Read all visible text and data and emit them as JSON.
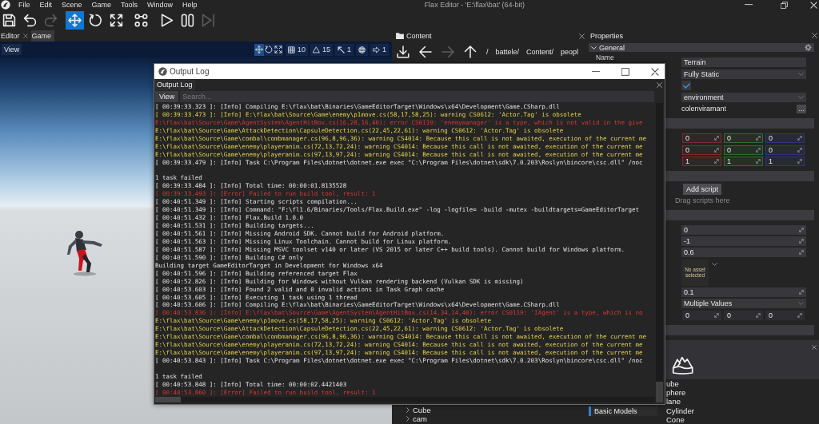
{
  "app": {
    "menu": [
      "File",
      "Edit",
      "Scene",
      "Game",
      "Tools",
      "Window",
      "Help"
    ],
    "title": "Flax Editor - 'E:\\flax\\bat' (64-bit)"
  },
  "toolbar": [
    {
      "kind": "save",
      "selected": false,
      "disabled": false
    },
    {
      "kind": "undo",
      "selected": false,
      "disabled": false
    },
    {
      "kind": "redo",
      "selected": false,
      "disabled": true
    },
    {
      "kind": "translate",
      "selected": true,
      "disabled": false
    },
    {
      "kind": "rotate",
      "selected": false,
      "disabled": false
    },
    {
      "kind": "scale",
      "selected": false,
      "disabled": false
    },
    {
      "kind": "snap",
      "selected": false,
      "disabled": false
    },
    {
      "kind": "play",
      "selected": false,
      "disabled": false
    },
    {
      "kind": "pause",
      "selected": false,
      "disabled": false
    },
    {
      "kind": "step",
      "selected": false,
      "disabled": true
    }
  ],
  "editor_tabs": [
    {
      "label": "Editor",
      "selected": true
    },
    {
      "label": "Game",
      "selected": false
    }
  ],
  "viewport": {
    "view_button": "View",
    "gizmo_modes": [
      {
        "kind": "translate",
        "selected": true
      },
      {
        "kind": "rotate",
        "selected": false
      },
      {
        "kind": "scale",
        "selected": false
      }
    ],
    "snapping": [
      {
        "kind": "grid",
        "value": "10"
      },
      {
        "kind": "angle",
        "value": "15"
      },
      {
        "kind": "scale",
        "value": "1"
      },
      {
        "kind": "space"
      },
      {
        "kind": "speed",
        "value": "1"
      }
    ]
  },
  "content": {
    "title": "Content",
    "nav": [
      {
        "kind": "import",
        "disabled": false
      },
      {
        "kind": "back",
        "disabled": false
      },
      {
        "kind": "forward",
        "disabled": true
      },
      {
        "kind": "up",
        "disabled": false
      }
    ],
    "path": [
      "/",
      "battele/",
      "Content/",
      "peopl"
    ],
    "tree": [
      {
        "label": "Cube",
        "expanded": false
      },
      {
        "label": "cam",
        "expanded": false
      }
    ]
  },
  "properties": {
    "title": "Properties",
    "group": {
      "label": "General",
      "expanded": true
    },
    "rows": [
      {
        "kind": "text",
        "label": "Name",
        "value": "Terrain"
      },
      {
        "kind": "dropdown",
        "value": "Fully Static"
      },
      {
        "kind": "checkbox",
        "checked": true
      },
      {
        "kind": "dropdown",
        "value": "environment"
      },
      {
        "kind": "reference",
        "value": "colenviramant",
        "button": "..."
      },
      {
        "kind": "group"
      },
      {
        "kind": "vector",
        "colored": true,
        "values": [
          "0",
          "0",
          "0"
        ]
      },
      {
        "kind": "vector",
        "colored": true,
        "values": [
          "0",
          "0",
          "0"
        ]
      },
      {
        "kind": "vector",
        "colored": true,
        "values": [
          "1",
          "1",
          "1"
        ]
      },
      {
        "kind": "group"
      },
      {
        "kind": "button",
        "label": "Add script"
      },
      {
        "kind": "hint",
        "text": "Drag scripts here"
      },
      {
        "kind": "group"
      },
      {
        "kind": "number",
        "value": "0"
      },
      {
        "kind": "number",
        "value": "-1"
      },
      {
        "kind": "number",
        "value": "0.6"
      },
      {
        "kind": "asset",
        "text": "No asset selected"
      },
      {
        "kind": "number",
        "value": "0.1"
      },
      {
        "kind": "dropdown",
        "value": "Multiple Values"
      },
      {
        "kind": "vector",
        "colored": false,
        "values": [
          "0",
          "0",
          "0"
        ]
      },
      {
        "kind": "group"
      }
    ]
  },
  "toolbox": {
    "tabs": [
      {
        "label": "Basic Models",
        "selected": true
      }
    ],
    "items": [
      "ube",
      "phere",
      "lane",
      "Cylinder",
      "Cone"
    ]
  },
  "output_log": {
    "title": "Output Log",
    "tab": "Output Log",
    "view_button": "View",
    "search": {
      "placeholder": "Search..."
    },
    "lines": [
      {
        "kind": "info",
        "text": "[ 00:39:33.323 ]: [Info] Compiling E:\\flax\\bat\\Binaries\\GameEditorTarget\\Windows\\x64\\Development\\Game.CSharp.dll"
      },
      {
        "kind": "warning",
        "text": "[ 00:39:33.473 ]: [Info] E:\\flax\\bat\\Source\\Game\\enemy\\p1move.cs(58,17,58,25): warning CS0612: 'Actor.Tag' is obsolete"
      },
      {
        "kind": "error",
        "text": "E:\\flax\\bat\\Source\\Game\\AgentSystem\\AgentHitBox.cs(16,28,16,40): error CS0119: 'enemymanager' is a type, which is not valid in the give"
      },
      {
        "kind": "warning",
        "text": "E:\\flax\\bat\\Source\\Game\\AttackDetection\\CapsuleDetection.cs(22,45,22,61): warning CS0612: 'Actor.Tag' is obsolete"
      },
      {
        "kind": "warning",
        "text": "E:\\flax\\bat\\Source\\Game\\combal\\combmanager.cs(96,8,96,36): warning CS4014: Because this call is not awaited, execution of the current me"
      },
      {
        "kind": "warning",
        "text": "E:\\flax\\bat\\Source\\Game\\enemy\\playeranim.cs(72,13,72,24): warning CS4014: Because this call is not awaited, execution of the current me"
      },
      {
        "kind": "warning",
        "text": "E:\\flax\\bat\\Source\\Game\\enemy\\playeranim.cs(97,13,97,24): warning CS4014: Because this call is not awaited, execution of the current me"
      },
      {
        "kind": "info",
        "text": "[ 00:39:33.479 ]: [Info] Task C:\\Program Files\\dotnet\\dotnet.exe exec \"C:\\Program Files\\dotnet\\sdk\\7.0.203\\Roslyn\\bincore\\csc.dll\" /noc"
      },
      {
        "kind": "blank"
      },
      {
        "kind": "info",
        "text": "1 task failed"
      },
      {
        "kind": "info",
        "text": "[ 00:39:33.484 ]: [Info] Total time: 00:00:01.8135528"
      },
      {
        "kind": "error",
        "text": "[ 00:39:33.493 ]: [Error] Failed to run build tool, result: 1"
      },
      {
        "kind": "info",
        "text": "[ 00:40:51.349 ]: [Info] Starting scripts compilation..."
      },
      {
        "kind": "info",
        "text": "[ 00:40:51.349 ]: [Info] Command: \"F:\\fl1.6/Binaries/Tools/Flax.Build.exe\" -log -logfile= -build -mutex -buildtargets=GameEditorTarget"
      },
      {
        "kind": "info",
        "text": "[ 00:40:51.432 ]: [Info] Flax.Build 1.0.0"
      },
      {
        "kind": "info",
        "text": "[ 00:40:51.531 ]: [Info] Building targets..."
      },
      {
        "kind": "info",
        "text": "[ 00:40:51.561 ]: [Info] Missing Android SDK. Cannot build for Android platform."
      },
      {
        "kind": "info",
        "text": "[ 00:40:51.563 ]: [Info] Missing Linux Toolchain. Cannot build for Linux platform."
      },
      {
        "kind": "info",
        "text": "[ 00:40:51.587 ]: [Info] Missing MSVC toolset v140 or later (VS 2015 or later C++ build tools). Cannot build for Windows platform."
      },
      {
        "kind": "info",
        "text": "[ 00:40:51.590 ]: [Info] Building C# only"
      },
      {
        "kind": "info",
        "text": "Building target GameEditorTarget in Development for Windows x64"
      },
      {
        "kind": "info",
        "text": "[ 00:40:51.596 ]: [Info] Building referenced target Flax"
      },
      {
        "kind": "info",
        "text": "[ 00:40:52.826 ]: [Info] Building for Windows without Vulkan rendering backend (Vulkan SDK is missing)"
      },
      {
        "kind": "info",
        "text": "[ 00:40:53.603 ]: [Info] Found 2 valid and 0 invalid actions in Task Graph cache"
      },
      {
        "kind": "info",
        "text": "[ 00:40:53.605 ]: [Info] Executing 1 task using 1 thread"
      },
      {
        "kind": "info",
        "text": "[ 00:40:53.606 ]: [Info] Compiling E:\\flax\\bat\\Binaries\\GameEditorTarget\\Windows\\x64\\Development\\Game.CSharp.dll"
      },
      {
        "kind": "error",
        "text": "[ 00:40:53.836 ]: [Info] E:\\flax\\bat\\Source\\Game\\AgentSystem\\AgentHitBox.cs(14,34,14,40): error CS0119: 'IAgent' is a type, which is no"
      },
      {
        "kind": "warning",
        "text": "E:\\flax\\bat\\Source\\Game\\enemy\\p1move.cs(58,17,58,25): warning CS0612: 'Actor.Tag' is obsolete"
      },
      {
        "kind": "warning",
        "text": "E:\\flax\\bat\\Source\\Game\\AttackDetection\\CapsuleDetection.cs(22,45,22,61): warning CS0612: 'Actor.Tag' is obsolete"
      },
      {
        "kind": "warning",
        "text": "E:\\flax\\bat\\Source\\Game\\combal\\combmanager.cs(96,8,96,36): warning CS4014: Because this call is not awaited, execution of the current me"
      },
      {
        "kind": "warning",
        "text": "E:\\flax\\bat\\Source\\Game\\enemy\\playeranim.cs(72,13,72,24): warning CS4014: Because this call is not awaited, execution of the current me"
      },
      {
        "kind": "warning",
        "text": "E:\\flax\\bat\\Source\\Game\\enemy\\playeranim.cs(97,13,97,24): warning CS4014: Because this call is not awaited, execution of the current me"
      },
      {
        "kind": "info",
        "text": "[ 00:40:53.843 ]: [Info] Task C:\\Program Files\\dotnet\\dotnet.exe exec \"C:\\Program Files\\dotnet\\sdk\\7.0.203\\Roslyn\\bincore\\csc.dll\" /noc"
      },
      {
        "kind": "blank"
      },
      {
        "kind": "info",
        "text": "1 task failed"
      },
      {
        "kind": "info",
        "text": "[ 00:40:53.848 ]: [Info] Total time: 00:00:02.4421403"
      },
      {
        "kind": "error",
        "text": "[ 00:40:53.860 ]: [Error] Failed to run build tool, result: 1"
      }
    ]
  }
}
